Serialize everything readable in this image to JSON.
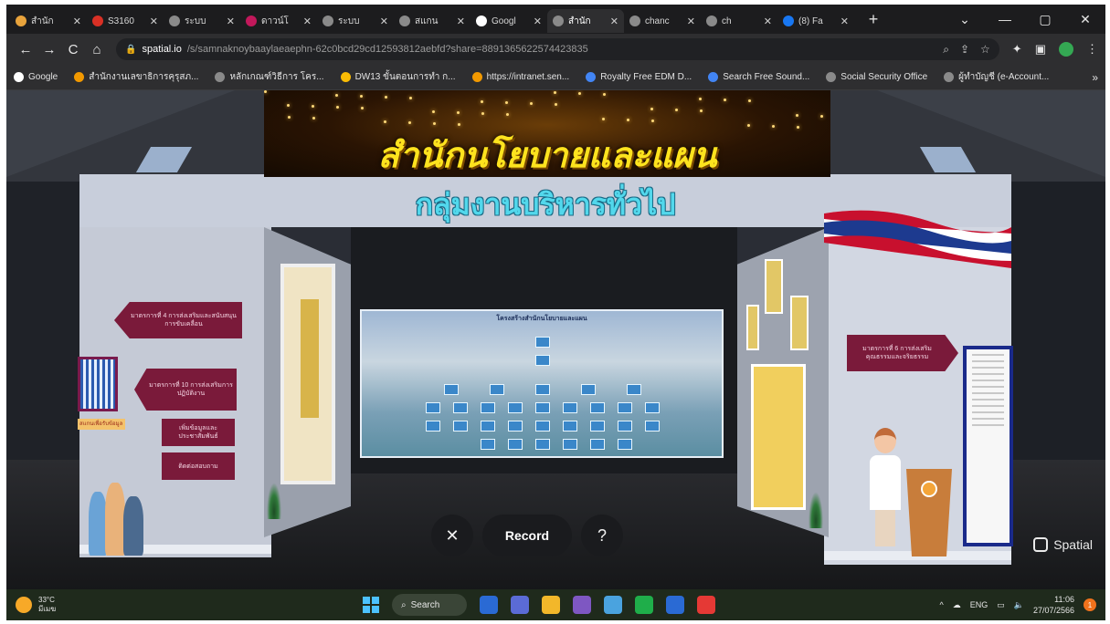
{
  "browser": {
    "tabs": [
      {
        "title": "สำนัก",
        "favicon_color": "#e8a33c",
        "active": false
      },
      {
        "title": "S3160",
        "favicon_color": "#d93025",
        "active": false
      },
      {
        "title": "ระบบ",
        "favicon_color": "#8a8a8a",
        "active": false
      },
      {
        "title": "ดาวน์โ",
        "favicon_color": "#c2185b",
        "active": false
      },
      {
        "title": "ระบบ",
        "favicon_color": "#8a8a8a",
        "active": false
      },
      {
        "title": "สแกน",
        "favicon_color": "#8a8a8a",
        "active": false
      },
      {
        "title": "Googl",
        "favicon_color": "#ffffff",
        "active": false
      },
      {
        "title": "สำนัก",
        "favicon_color": "#8a8a8a",
        "active": true
      },
      {
        "title": "chanc",
        "favicon_color": "#8a8a8a",
        "active": false
      },
      {
        "title": "ch",
        "favicon_color": "#8a8a8a",
        "active": false
      },
      {
        "title": "(8) Fa",
        "favicon_color": "#1877f2",
        "active": false
      }
    ],
    "new_tab_label": "+",
    "window_controls": [
      "⌄",
      "—",
      "▢",
      "✕"
    ],
    "nav": {
      "back": "←",
      "forward": "→",
      "reload": "C",
      "home": "⌂"
    },
    "url_domain": "spatial.io",
    "url_path": "/s/samnaknoybaaylaeaephn-62c0bcd29cd12593812aebfd?share=8891365622574423835",
    "bookmarks": [
      {
        "label": "Google",
        "color": "#ffffff"
      },
      {
        "label": "สำนักงานเลขาธิการคุรุสภ...",
        "color": "#f29900"
      },
      {
        "label": "หลักเกณฑ์วิธีการ โคร...",
        "color": "#8a8a8a"
      },
      {
        "label": "DW13 ขั้นตอนการทำ ก...",
        "color": "#fbbc04"
      },
      {
        "label": "https://intranet.sen...",
        "color": "#f29900"
      },
      {
        "label": "Royalty Free EDM D...",
        "color": "#4285f4"
      },
      {
        "label": "Search Free Sound...",
        "color": "#4285f4"
      },
      {
        "label": "Social Security Office",
        "color": "#8a8a8a"
      },
      {
        "label": "ผู้ทำบัญชี (e-Account...",
        "color": "#8a8a8a"
      }
    ],
    "bookmarks_more": "»"
  },
  "scene": {
    "header_title": "สำนักนโยบายและแผน",
    "subtitle": "กลุ่มงานบริหารทั่วไป",
    "screen_title": "โครงสร้างสำนักนโยบายและแผน",
    "left_signs": [
      "มาตรการที่ 4 การส่งเสริมและสนับสนุนการขับเคลื่อน",
      "มาตรการที่ 10 การส่งเสริมการปฏิบัติงาน",
      "เพิ่มข้อมูลและประชาสัมพันธ์",
      "ติดต่อสอบถาม"
    ],
    "right_sign": "มาตรการที่ 6 การส่งเสริมคุณธรรมและจริยธรรม",
    "sticky_note": "สแกนเพื่อรับข้อมูล",
    "overlay": {
      "close": "✕",
      "record": "Record",
      "help": "?"
    },
    "brand": "Spatial"
  },
  "taskbar": {
    "weather_temp": "33°C",
    "weather_cond": "มีเมฆ",
    "search_label": "Search",
    "apps": [
      "#2a6ad4",
      "#5b6bd6",
      "#f2b72a",
      "#7e57c2",
      "#4aa3df",
      "#1fae4a",
      "#2a6ad4",
      "#e53935"
    ],
    "lang": "ENG",
    "time": "11:06",
    "date": "27/07/2566",
    "notification_count": "1"
  }
}
